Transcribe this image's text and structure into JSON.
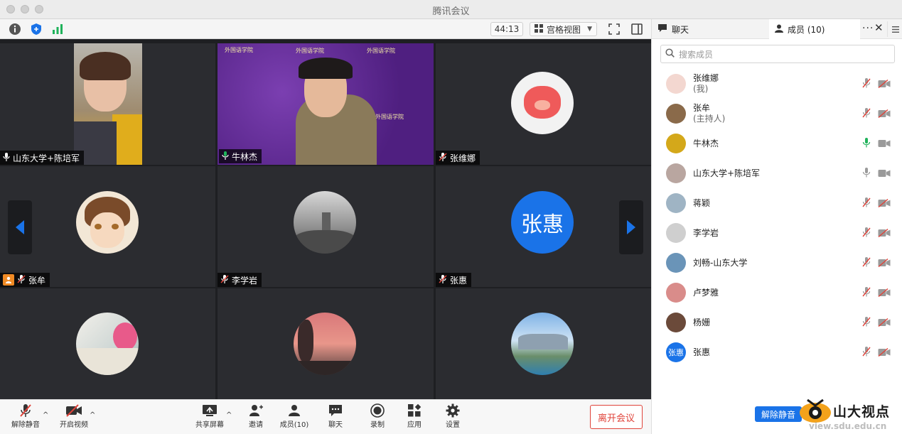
{
  "window": {
    "title": "腾讯会议"
  },
  "toolbar": {
    "timer": "44:13",
    "view_label": "宫格视图",
    "icons": [
      "info-icon",
      "shield-icon",
      "signal-icon",
      "grid-icon",
      "fullscreen-icon",
      "sidebar-icon"
    ]
  },
  "tiles": [
    {
      "name": "山东大学+陈培军",
      "mic": "on"
    },
    {
      "name": "牛林杰",
      "mic": "active",
      "background_text": "外国语学院"
    },
    {
      "name": "张维娜",
      "mic": "muted"
    },
    {
      "name": "张牟",
      "mic": "muted",
      "host": true
    },
    {
      "name": "李学岩",
      "mic": "muted"
    },
    {
      "name": "张惠",
      "mic": "muted",
      "avatar_text": "张惠"
    },
    {
      "name": "",
      "mic": "muted"
    },
    {
      "name": "",
      "mic": "muted"
    },
    {
      "name": "",
      "mic": "muted"
    }
  ],
  "bottombar": {
    "unmute": "解除静音",
    "start_video": "开启视频",
    "share": "共享屏幕",
    "invite": "邀请",
    "members": "成员(10)",
    "chat": "聊天",
    "record": "录制",
    "apps": "应用",
    "settings": "设置",
    "leave": "离开会议"
  },
  "panel": {
    "chat_tab": "聊天",
    "members_tab": "成员 (10)",
    "search_placeholder": "搜索成员",
    "unmute_button": "解除静音",
    "members": [
      {
        "name": "张维娜",
        "sub": "(我)",
        "mic": "muted",
        "cam": "off"
      },
      {
        "name": "张牟",
        "sub": "(主持人)",
        "mic": "muted",
        "cam": "off"
      },
      {
        "name": "牛林杰",
        "sub": "",
        "mic": "active",
        "cam": "on"
      },
      {
        "name": "山东大学+陈培军",
        "sub": "",
        "mic": "on",
        "cam": "on"
      },
      {
        "name": "蒋颖",
        "sub": "",
        "mic": "muted",
        "cam": "off"
      },
      {
        "name": "李学岩",
        "sub": "",
        "mic": "muted",
        "cam": "off"
      },
      {
        "name": "刘畅-山东大学",
        "sub": "",
        "mic": "muted",
        "cam": "off"
      },
      {
        "name": "卢梦雅",
        "sub": "",
        "mic": "muted",
        "cam": "off"
      },
      {
        "name": "杨姗",
        "sub": "",
        "mic": "muted",
        "cam": "off"
      },
      {
        "name": "张惠",
        "sub": "",
        "mic": "muted",
        "cam": "off",
        "avatar_text": "张惠"
      }
    ]
  },
  "watermark": {
    "text": "山大视点",
    "url": "view.sdu.edu.cn"
  },
  "colors": {
    "accent": "#1a73e8",
    "active_green": "#1fb25a",
    "leave_red": "#e0433a",
    "muted_red": "#e0433a"
  }
}
